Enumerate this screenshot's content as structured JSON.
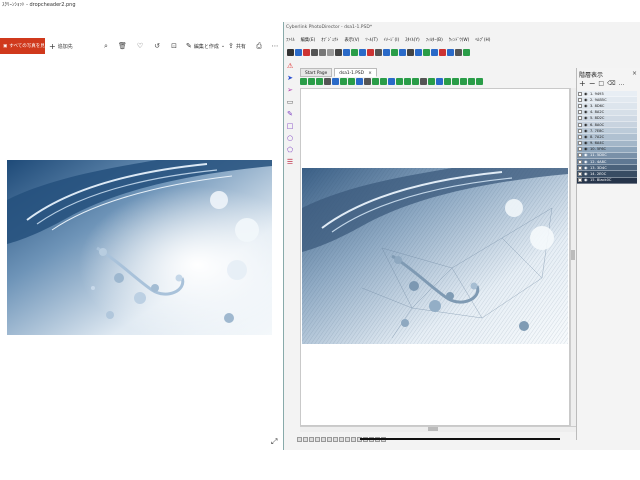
{
  "viewer": {
    "title": "ｽｸﾘｰﾝｼｮｯﾄ - dropcheader2.png",
    "open_label": "すべての写真を見る",
    "add_to_label": "追加先",
    "edit_create_label": "編集と作成",
    "share_label": "共有",
    "toolbar_icons": [
      "zoom-icon",
      "delete-icon",
      "favorite-icon",
      "rotate-icon",
      "crop-icon",
      "more-icon"
    ]
  },
  "app": {
    "title": "Cyberlink PhotoDirector - dsa1-1.PSD*",
    "menu": [
      "ﾌｧｲﾙ",
      "編集(E)",
      "ｵﾌﾞｼﾞｪｸﾄ",
      "表示(V)",
      "ﾂｰﾙ(T)",
      "ｲﾒｰｼﾞ(I)",
      "ｽﾀｲﾙ(Y)",
      "ﾌｨﾙﾀｰ(B)",
      "ｳｨﾝﾄﾞｳ(W)",
      "ﾍﾙﾌﾟ(H)"
    ],
    "tabs": [
      "Start Page",
      "dsa1-1.PSD"
    ],
    "tab_close": "×",
    "toolbar1_colors": [
      "#333333",
      "#2a6ac8",
      "#cc3333",
      "#555555",
      "#777777",
      "#999999",
      "#444444",
      "#2a6ac8",
      "#2a9d48",
      "#2a6ac8",
      "#cc3333",
      "#555555",
      "#2a6ac8",
      "#2a9d48",
      "#2a6ac8",
      "#444444",
      "#2a6ac8",
      "#2a9d48",
      "#2a6ac8",
      "#cc3333",
      "#2a6ac8",
      "#555555",
      "#2a9d48"
    ],
    "toolbar2_colors": [
      "#2a9d48",
      "#2a9d48",
      "#2a9d48",
      "#555555",
      "#2a6ac8",
      "#2a9d48",
      "#2a9d48",
      "#2a6ac8",
      "#555555",
      "#2a9d48",
      "#2a9d48",
      "#2a6ac8",
      "#2a9d48",
      "#2a9d48",
      "#2a9d48",
      "#555555",
      "#2a9d48",
      "#2a6ac8",
      "#2a9d48",
      "#2a9d48",
      "#2a9d48",
      "#2a9d48",
      "#2a9d48"
    ],
    "tools": [
      "select-arrow-icon",
      "direct-select-icon",
      "monitor-icon",
      "pen-icon",
      "rectangle-icon",
      "ellipse-icon",
      "polygon-icon",
      "layers-stack-icon"
    ],
    "warning_icon": "⚠"
  },
  "layers_panel": {
    "title": "階層表示",
    "close": "×",
    "items": [
      {
        "label": "1. 9493",
        "bg": "#e8eef4",
        "fg": "#222"
      },
      {
        "label": "2. 9AB5C",
        "bg": "#e2e9f0",
        "fg": "#222"
      },
      {
        "label": "3. 8D6C",
        "bg": "#dde5ed",
        "fg": "#222"
      },
      {
        "label": "4. 8A2C",
        "bg": "#d6dfe8",
        "fg": "#222"
      },
      {
        "label": "5. 8D2C",
        "bg": "#cfd9e4",
        "fg": "#222"
      },
      {
        "label": "6. 8A0C",
        "bg": "#c8d3df",
        "fg": "#222"
      },
      {
        "label": "7. 7E8C",
        "bg": "#bccbd9",
        "fg": "#222"
      },
      {
        "label": "8. 7A2C",
        "bg": "#b0c1d1",
        "fg": "#222"
      },
      {
        "label": "9. 6A4C",
        "bg": "#a3b6c8",
        "fg": "#222"
      },
      {
        "label": "10. 5F6C",
        "bg": "#8ea5bb",
        "fg": "#222"
      },
      {
        "label": "11. 5D0C",
        "bg": "#7990a8",
        "fg": "#fff"
      },
      {
        "label": "12. 4A8C",
        "bg": "#5f7893",
        "fg": "#fff"
      },
      {
        "label": "13. 3D4C",
        "bg": "#4b627b",
        "fg": "#fff"
      },
      {
        "label": "14. 2E0C",
        "bg": "#384c63",
        "fg": "#fff"
      },
      {
        "label": "15. Black0C",
        "bg": "#25344a",
        "fg": "#fff"
      }
    ],
    "toolbar": [
      "+",
      "−",
      "□",
      "⌫",
      "…"
    ]
  },
  "status": {
    "segments": 15
  }
}
